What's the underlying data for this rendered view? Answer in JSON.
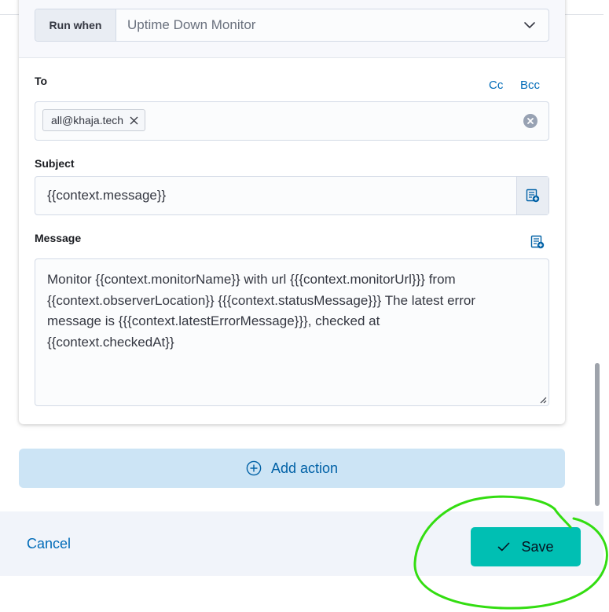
{
  "action": {
    "run_when": {
      "label": "Run when",
      "value": "Uptime Down Monitor",
      "icon": "chevron-down-icon"
    },
    "to": {
      "label": "To",
      "cc_label": "Cc",
      "bcc_label": "Bcc",
      "recipients": [
        "all@khaja.tech"
      ]
    },
    "subject": {
      "label": "Subject",
      "value": "{{context.message}}"
    },
    "message": {
      "label": "Message",
      "value": "Monitor {{context.monitorName}} with url {{{context.monitorUrl}}} from\n{{context.observerLocation}} {{{context.statusMessage}}} The latest error\nmessage is {{{context.latestErrorMessage}}}, checked at\n{{context.checkedAt}}"
    }
  },
  "add_action": {
    "label": "Add action",
    "icon": "plus-circle-icon"
  },
  "footer": {
    "cancel_label": "Cancel",
    "save_label": "Save",
    "save_icon": "check-icon"
  },
  "colors": {
    "accent": "#00bfb3",
    "link": "#006bb8",
    "annotation": "#33dd11"
  }
}
